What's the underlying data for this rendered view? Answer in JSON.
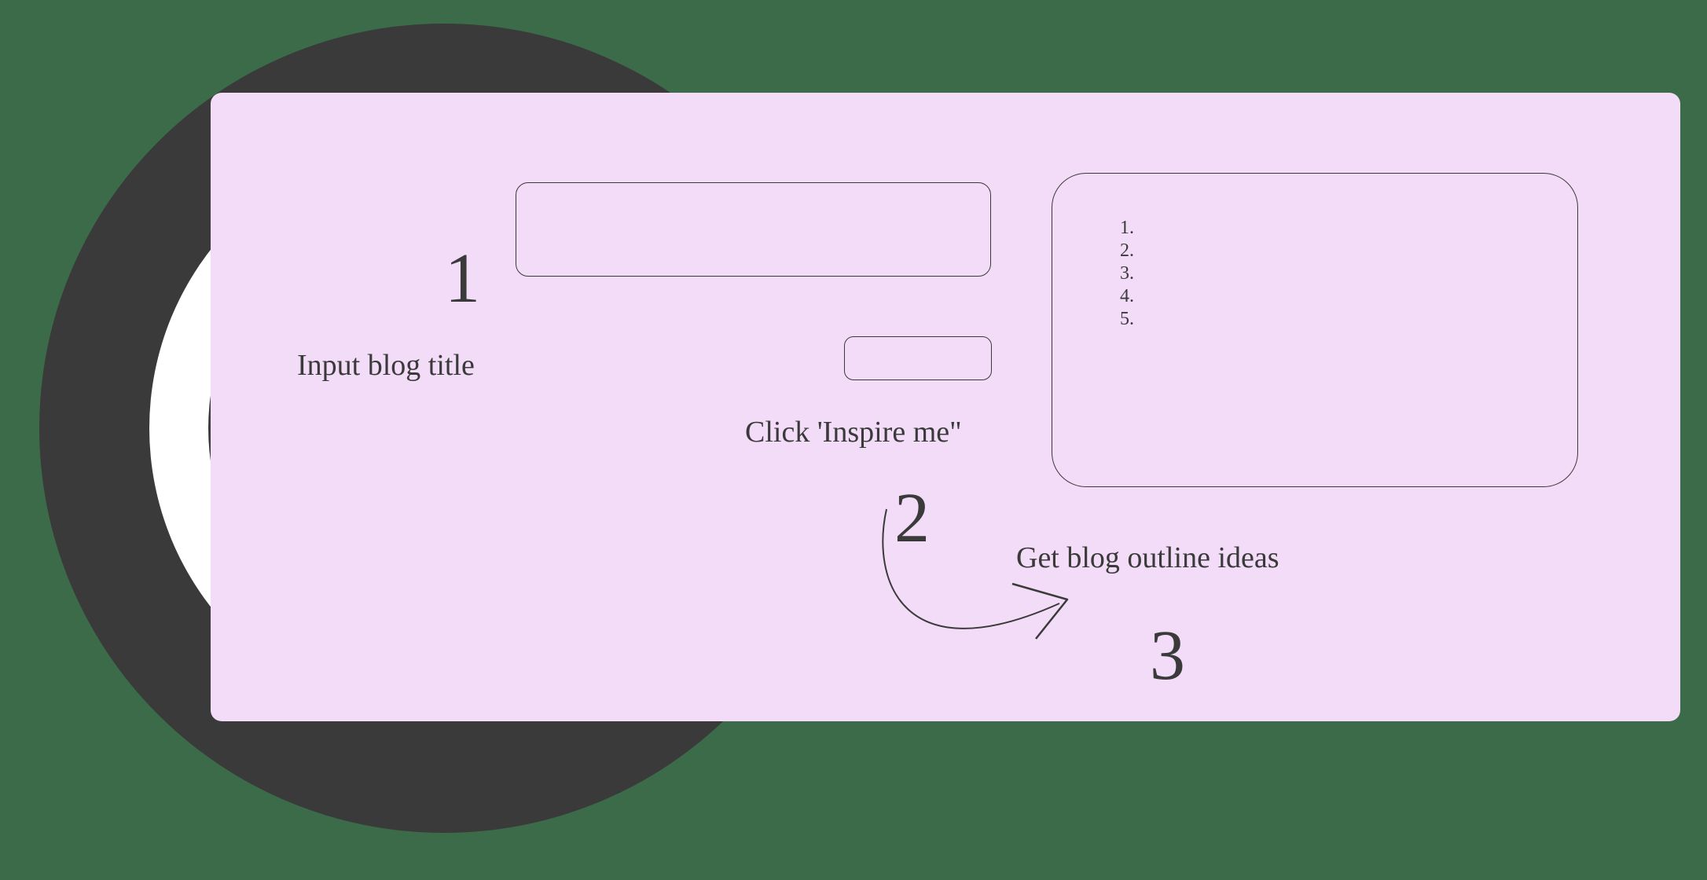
{
  "steps": {
    "one": {
      "number": "1",
      "label": "Input blog title"
    },
    "two": {
      "number": "2",
      "label": "Click 'Inspire me\""
    },
    "three": {
      "number": "3",
      "label": "Get blog outline ideas"
    }
  },
  "outline_items": [
    "",
    "",
    "",
    "",
    ""
  ]
}
